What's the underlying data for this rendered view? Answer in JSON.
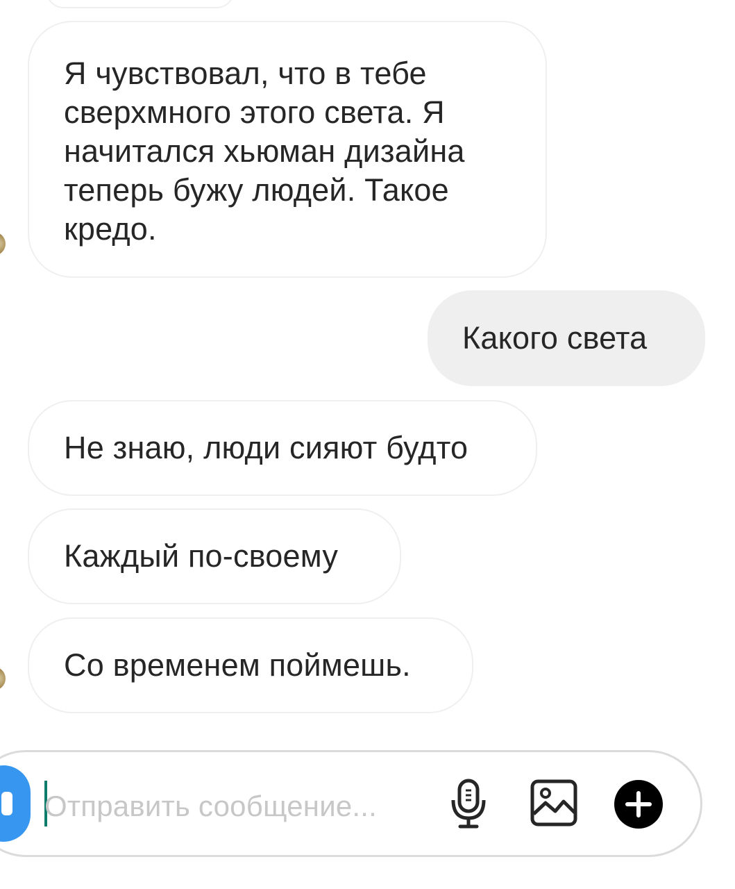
{
  "messages": [
    {
      "direction": "incoming",
      "text": "Я чувствовал, что в тебе\nсверхмного этого света. Я\nначитался хьюман дизайна\nтеперь бужу людей. Такое\nкредо."
    },
    {
      "direction": "outgoing",
      "text": "Какого света"
    },
    {
      "direction": "incoming",
      "text": "Не знаю, люди сияют будто"
    },
    {
      "direction": "incoming",
      "text": "Каждый по-своему"
    },
    {
      "direction": "incoming",
      "text": "Со временем поймешь."
    }
  ],
  "composer": {
    "placeholder": "Отправить сообщение...",
    "icons": [
      "camera-icon",
      "microphone-icon",
      "gallery-icon",
      "plus-icon"
    ]
  },
  "colors": {
    "incoming_border": "#efefef",
    "outgoing_bg": "#efefef",
    "text": "#262626",
    "placeholder": "#c7c7c7",
    "camera_button": "#3797f0",
    "caret": "#0e7c6b"
  }
}
